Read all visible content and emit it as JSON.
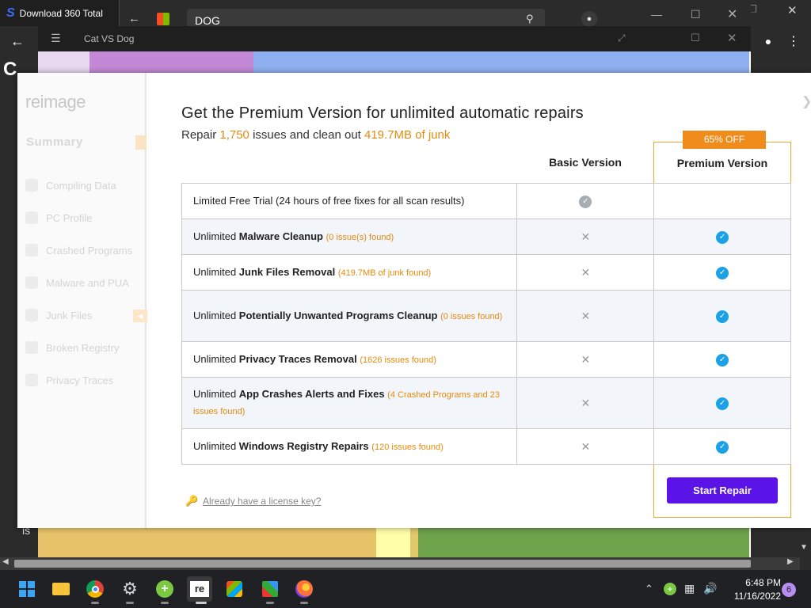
{
  "browser": {
    "tab_title": "Download 360 Total",
    "tab_logo": "S",
    "page_letter": "C",
    "address_value": "DOG"
  },
  "game_window": {
    "title": "Cat VS Dog",
    "page_text": "is"
  },
  "dialog": {
    "logo": "reimage",
    "sidebar": {
      "summary": "Summary",
      "items": [
        {
          "label": "Compiling Data"
        },
        {
          "label": "PC Profile"
        },
        {
          "label": "Crashed Programs"
        },
        {
          "label": "Malware and PUA"
        },
        {
          "label": "Junk Files"
        },
        {
          "label": "Broken Registry"
        },
        {
          "label": "Privacy Traces"
        }
      ]
    },
    "headline": "Get the Premium Version for unlimited automatic repairs",
    "sub_prefix": "Repair ",
    "issues_count": "1,750",
    "sub_mid": " issues and clean out ",
    "junk_size": "419.7MB of junk",
    "discount_badge": "65% OFF",
    "col_basic": "Basic Version",
    "col_premium": "Premium Version",
    "rows": [
      {
        "pre": "Limited Free Trial (24 hours of free fixes for all scan results)",
        "bold": "",
        "note": ""
      },
      {
        "pre": "Unlimited ",
        "bold": "Malware Cleanup",
        "note": "(0 issue(s) found)"
      },
      {
        "pre": "Unlimited ",
        "bold": "Junk Files Removal",
        "note": "(419.7MB of junk found)"
      },
      {
        "pre": "Unlimited ",
        "bold": "Potentially Unwanted Programs Cleanup",
        "note": "(0 issues found)"
      },
      {
        "pre": "Unlimited ",
        "bold": "Privacy Traces Removal",
        "note": "(1626 issues found)"
      },
      {
        "pre": "Unlimited ",
        "bold": "App Crashes Alerts and Fixes",
        "note": "(4 Crashed Programs and 23 issues found)"
      },
      {
        "pre": "Unlimited ",
        "bold": "Windows Registry Repairs",
        "note": "(120 issues found)"
      }
    ],
    "start_button": "Start Repair",
    "license_link": "Already have a license key?"
  },
  "taskbar": {
    "time": "6:48 PM",
    "date": "11/16/2022",
    "notifications": "6",
    "reimage_label": "re"
  }
}
